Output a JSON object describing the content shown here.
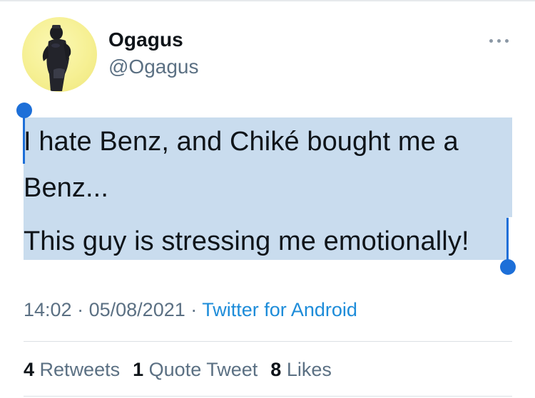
{
  "tweet": {
    "author": {
      "display_name": "Ogagus",
      "handle": "@Ogagus",
      "avatar_icon": "person-photo-avatar"
    },
    "text_lines": [
      "I hate Benz, and Chiké bought me a",
      "Benz...",
      "This guy is stressing me emotionally!"
    ],
    "text_selected": true,
    "time": "14:02",
    "date": "05/08/2021",
    "separator": "·",
    "source": "Twitter for Android",
    "stats": {
      "retweets": {
        "count": "4",
        "label": "Retweets"
      },
      "quote_tweets": {
        "count": "1",
        "label": "Quote Tweet"
      },
      "likes": {
        "count": "8",
        "label": "Likes"
      }
    }
  },
  "menu_icon": "more-horizontal-icon",
  "colors": {
    "selection": "#c9dcee",
    "selection_handle": "#1d6fd8",
    "link": "#1d8cd9",
    "secondary_text": "#5b7083",
    "primary_text": "#0f1419"
  }
}
